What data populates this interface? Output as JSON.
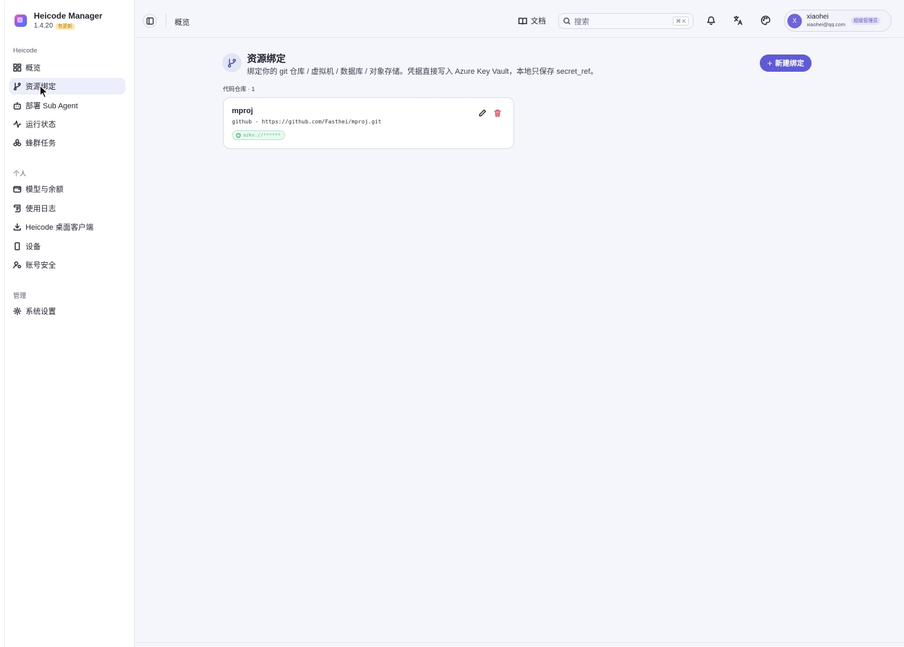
{
  "brand": {
    "name": "Heicode Manager",
    "version": "1.4.20",
    "badge": "有更新"
  },
  "sidebar": {
    "groups": [
      {
        "title": "Heicode",
        "items": [
          {
            "label": "概览",
            "icon": "dashboard-icon"
          },
          {
            "label": "资源绑定",
            "icon": "git-branch-icon",
            "active": true
          },
          {
            "label": "部署 Sub Agent",
            "icon": "bot-icon"
          },
          {
            "label": "运行状态",
            "icon": "activity-icon"
          },
          {
            "label": "蜂群任务",
            "icon": "swarm-icon"
          }
        ]
      },
      {
        "title": "个人",
        "items": [
          {
            "label": "模型与余额",
            "icon": "wallet-icon"
          },
          {
            "label": "使用日志",
            "icon": "scroll-icon"
          },
          {
            "label": "Heicode 桌面客户端",
            "icon": "download-icon"
          },
          {
            "label": "设备",
            "icon": "device-icon"
          },
          {
            "label": "账号安全",
            "icon": "user-lock-icon"
          }
        ]
      },
      {
        "title": "管理",
        "items": [
          {
            "label": "系统设置",
            "icon": "gear-icon"
          }
        ]
      }
    ]
  },
  "topbar": {
    "breadcrumb": "概览",
    "docs_label": "文档",
    "search_placeholder": "搜索",
    "search_shortcut": "⌘ K"
  },
  "user": {
    "initial": "X",
    "name": "xiaohei",
    "email": "xiaohei@qq.com",
    "role": "超级管理员",
    "avatar_color": "#6d63dd"
  },
  "page": {
    "title": "资源绑定",
    "subtitle": "绑定你的 git 仓库 / 虚拟机 / 数据库 / 对象存储。凭据直接写入 Azure Key Vault，本地只保存 secret_ref。",
    "new_button": "新建绑定",
    "section_label": "代码仓库 · 1"
  },
  "bindings": [
    {
      "name": "mproj",
      "provider_url": "github · https://github.com/Fasthei/mproj.git",
      "secret_ref": "azkv://******"
    }
  ],
  "colors": {
    "accent": "#5f5ad8",
    "active_nav": "#eceefb",
    "secret_green": "#5fbf8a",
    "danger": "#e05563"
  }
}
